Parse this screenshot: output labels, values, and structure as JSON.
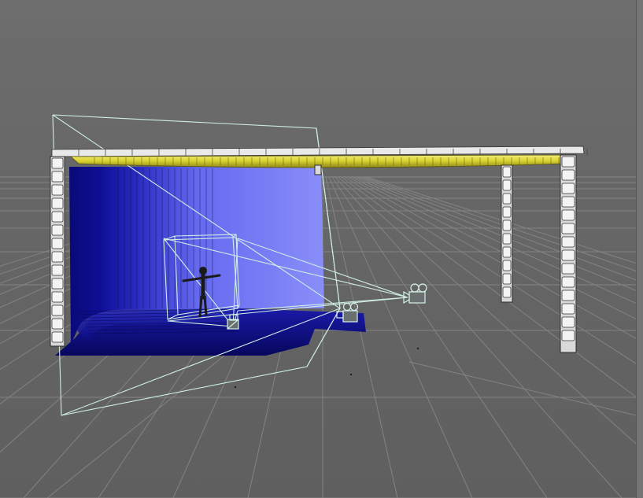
{
  "viewport": {
    "mode": "perspective",
    "background_top": "#6e6e6e",
    "background_horizon": "#676767",
    "background_bottom": "#5f5f5f",
    "grid_color": "#838383",
    "selection_wire_color": "#cfeee4"
  },
  "scene": {
    "objects": [
      {
        "name": "cyclorama-backdrop",
        "color": "#6f73f6",
        "shade": "#0b0b8a"
      },
      {
        "name": "light-rig-truss",
        "color": "#e8e8e8"
      },
      {
        "name": "light-bar",
        "color": "#d8d23a"
      },
      {
        "name": "character-figure",
        "color": "#1a1a1a"
      },
      {
        "name": "camera-main",
        "icon": "film-camera-icon"
      },
      {
        "name": "camera-secondary",
        "icon": "film-camera-icon"
      },
      {
        "name": "camera-tertiary",
        "icon": "film-camera-icon"
      }
    ]
  }
}
